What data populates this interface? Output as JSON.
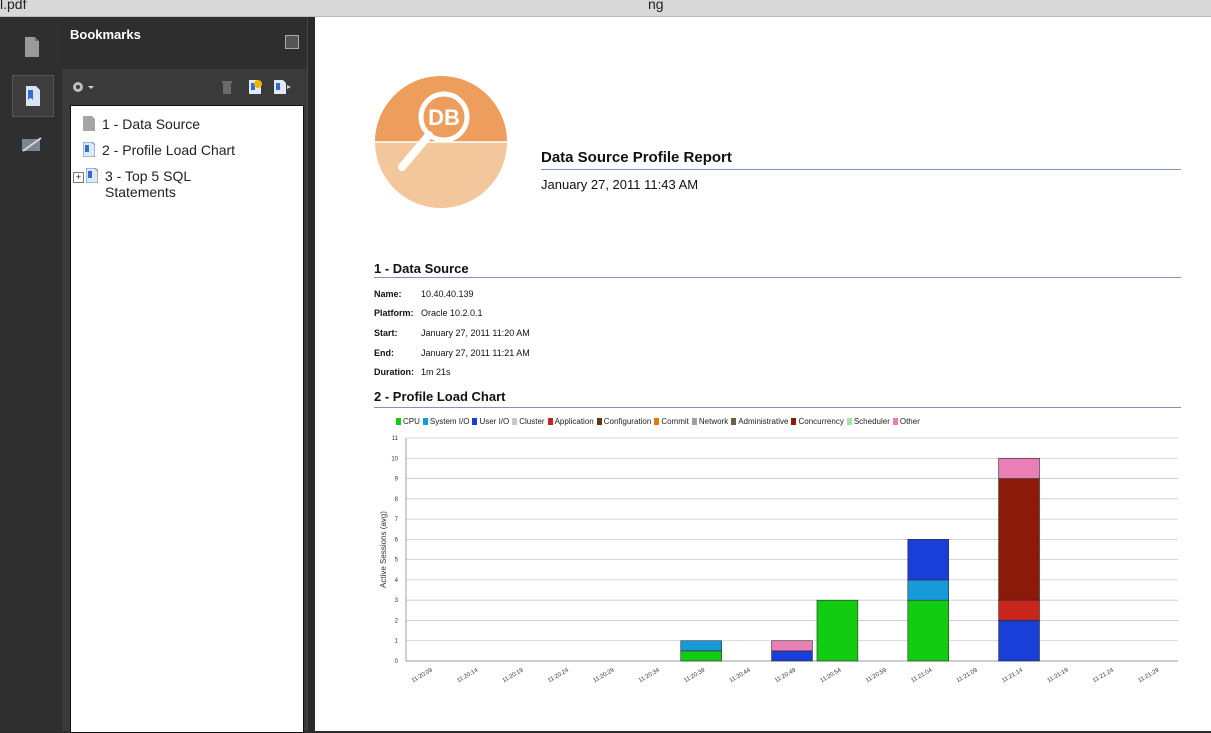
{
  "window": {
    "title_fragment_left": "l.pdf",
    "title_fragment_right": "ng"
  },
  "rail": {
    "icons": [
      "pages-icon",
      "bookmarks-icon",
      "signatures-icon"
    ]
  },
  "bookmarks": {
    "title": "Bookmarks",
    "items": [
      {
        "label": "1 - Data Source",
        "expandable": false
      },
      {
        "label": "2 - Profile Load Chart",
        "expandable": false
      },
      {
        "label_line1": "3 - Top 5 SQL",
        "label_line2": "Statements",
        "expandable": true
      }
    ]
  },
  "report": {
    "logo_text": "DB",
    "title": "Data Source Profile Report",
    "date": "January 27, 2011 11:43 AM",
    "section1_title": "1 - Data Source",
    "fields": [
      {
        "key": "Name:",
        "value": "10.40.40.139"
      },
      {
        "key": "Platform:",
        "value": "Oracle 10.2.0.1"
      },
      {
        "key": "Start:",
        "value": "January 27, 2011 11:20 AM"
      },
      {
        "key": "End:",
        "value": "January 27, 2011 11:21 AM"
      },
      {
        "key": "Duration:",
        "value": "1m 21s"
      }
    ],
    "section2_title": "2 - Profile Load Chart"
  },
  "chart_data": {
    "type": "bar",
    "stacked": true,
    "title": "",
    "xlabel": "",
    "ylabel": "Active Sessions (avg)",
    "ylim": [
      0,
      11
    ],
    "yticks": [
      0,
      1,
      2,
      3,
      4,
      5,
      6,
      7,
      8,
      9,
      10,
      11
    ],
    "grid": true,
    "legend_position": "top",
    "categories": [
      "11:20:09",
      "11:20:14",
      "11:20:19",
      "11:20:24",
      "11:20:29",
      "11:20:34",
      "11:20:39",
      "11:20:44",
      "11:20:49",
      "11:20:54",
      "11:20:59",
      "11:21:04",
      "11:21:09",
      "11:21:14",
      "11:21:19",
      "11:21:24",
      "11:21:29"
    ],
    "series": [
      {
        "name": "CPU",
        "color": "#11cc11",
        "values": [
          0,
          0,
          0,
          0,
          0,
          0,
          0.5,
          0,
          0,
          3,
          0,
          3,
          0,
          0,
          0,
          0,
          0
        ]
      },
      {
        "name": "System I/O",
        "color": "#1899d8",
        "values": [
          0,
          0,
          0,
          0,
          0,
          0,
          0.5,
          0,
          0,
          0,
          0,
          1,
          0,
          0,
          0,
          0,
          0
        ]
      },
      {
        "name": "User I/O",
        "color": "#1a3ed8",
        "values": [
          0,
          0,
          0,
          0,
          0,
          0,
          0,
          0,
          0.5,
          0,
          0,
          2,
          0,
          2,
          0,
          0,
          0
        ]
      },
      {
        "name": "Cluster",
        "color": "#c8c8c8",
        "values": [
          0,
          0,
          0,
          0,
          0,
          0,
          0,
          0,
          0,
          0,
          0,
          0,
          0,
          0,
          0,
          0,
          0
        ]
      },
      {
        "name": "Application",
        "color": "#c8261c",
        "values": [
          0,
          0,
          0,
          0,
          0,
          0,
          0,
          0,
          0,
          0,
          0,
          0,
          0,
          1,
          0,
          0,
          0
        ]
      },
      {
        "name": "Configuration",
        "color": "#5c3a1c",
        "values": [
          0,
          0,
          0,
          0,
          0,
          0,
          0,
          0,
          0,
          0,
          0,
          0,
          0,
          0,
          0,
          0,
          0
        ]
      },
      {
        "name": "Commit",
        "color": "#e07a10",
        "values": [
          0,
          0,
          0,
          0,
          0,
          0,
          0,
          0,
          0,
          0,
          0,
          0,
          0,
          0,
          0,
          0,
          0
        ]
      },
      {
        "name": "Network",
        "color": "#9aa39a",
        "values": [
          0,
          0,
          0,
          0,
          0,
          0,
          0,
          0,
          0,
          0,
          0,
          0,
          0,
          0,
          0,
          0,
          0
        ]
      },
      {
        "name": "Administrative",
        "color": "#6e6040",
        "values": [
          0,
          0,
          0,
          0,
          0,
          0,
          0,
          0,
          0,
          0,
          0,
          0,
          0,
          0,
          0,
          0,
          0
        ]
      },
      {
        "name": "Concurrency",
        "color": "#8b1a0a",
        "values": [
          0,
          0,
          0,
          0,
          0,
          0,
          0,
          0,
          0,
          0,
          0,
          0,
          0,
          6,
          0,
          0,
          0
        ]
      },
      {
        "name": "Scheduler",
        "color": "#a6e3a6",
        "values": [
          0,
          0,
          0,
          0,
          0,
          0,
          0,
          0,
          0,
          0,
          0,
          0,
          0,
          0,
          0,
          0,
          0
        ]
      },
      {
        "name": "Other",
        "color": "#ea7fb6",
        "values": [
          0,
          0,
          0,
          0,
          0,
          0,
          0,
          0,
          0.5,
          0,
          0,
          0,
          0,
          1,
          0,
          0,
          0
        ]
      }
    ]
  }
}
